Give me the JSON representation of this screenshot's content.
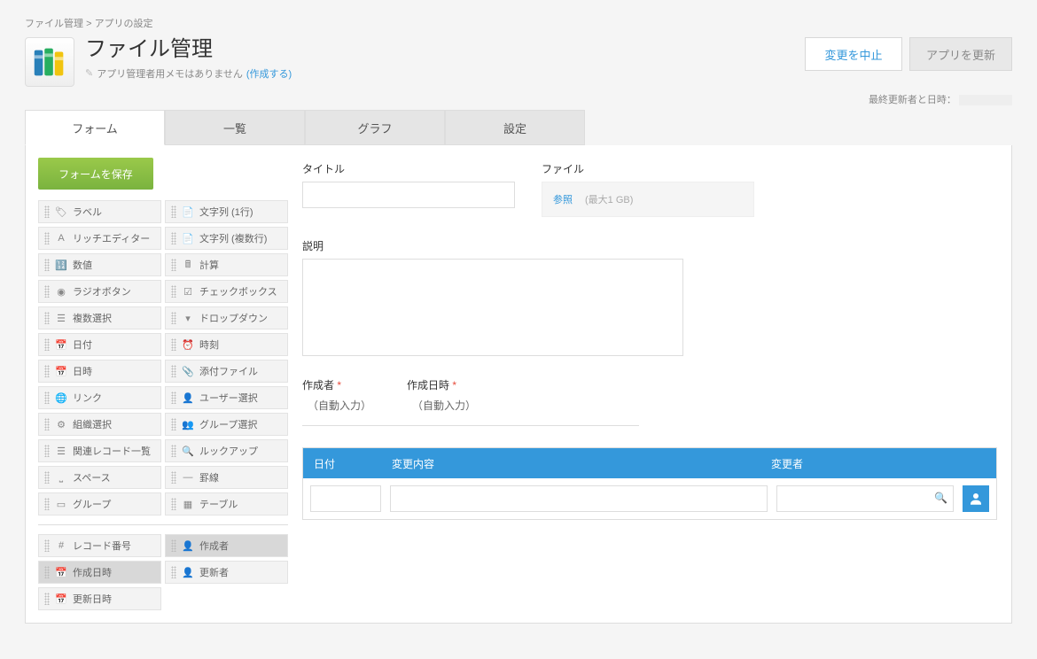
{
  "breadcrumb": {
    "root": "ファイル管理",
    "sep": ">",
    "current": "アプリの設定"
  },
  "app": {
    "title": "ファイル管理",
    "memo_text": "アプリ管理者用メモはありません",
    "memo_link": "(作成する)"
  },
  "actions": {
    "cancel": "変更を中止",
    "update": "アプリを更新"
  },
  "last_updated_label": "最終更新者と日時：",
  "tabs": {
    "form": "フォーム",
    "list": "一覧",
    "graph": "グラフ",
    "settings": "設定"
  },
  "sidebar": {
    "save_form": "フォームを保存",
    "palette": {
      "label": "ラベル",
      "text1": "文字列 (1行)",
      "rich": "リッチエディター",
      "textmulti": "文字列 (複数行)",
      "number": "数値",
      "calc": "計算",
      "radio": "ラジオボタン",
      "checkbox": "チェックボックス",
      "multiselect": "複数選択",
      "dropdown": "ドロップダウン",
      "date": "日付",
      "time": "時刻",
      "datetime": "日時",
      "attach": "添付ファイル",
      "link": "リンク",
      "usersel": "ユーザー選択",
      "orgsel": "組織選択",
      "groupsel": "グループ選択",
      "related": "関連レコード一覧",
      "lookup": "ルックアップ",
      "space": "スペース",
      "hr": "罫線",
      "group": "グループ",
      "table": "テーブル",
      "recnum": "レコード番号",
      "creator": "作成者",
      "created_at": "作成日時",
      "modifier": "更新者",
      "updated_at": "更新日時"
    }
  },
  "form": {
    "title_label": "タイトル",
    "file_label": "ファイル",
    "file_browse": "参照",
    "file_max": "(最大1 GB)",
    "desc_label": "説明",
    "creator_label": "作成者",
    "created_at_label": "作成日時",
    "auto": "（自動入力）"
  },
  "subtable": {
    "h_date": "日付",
    "h_content": "変更内容",
    "h_modifier": "変更者"
  }
}
